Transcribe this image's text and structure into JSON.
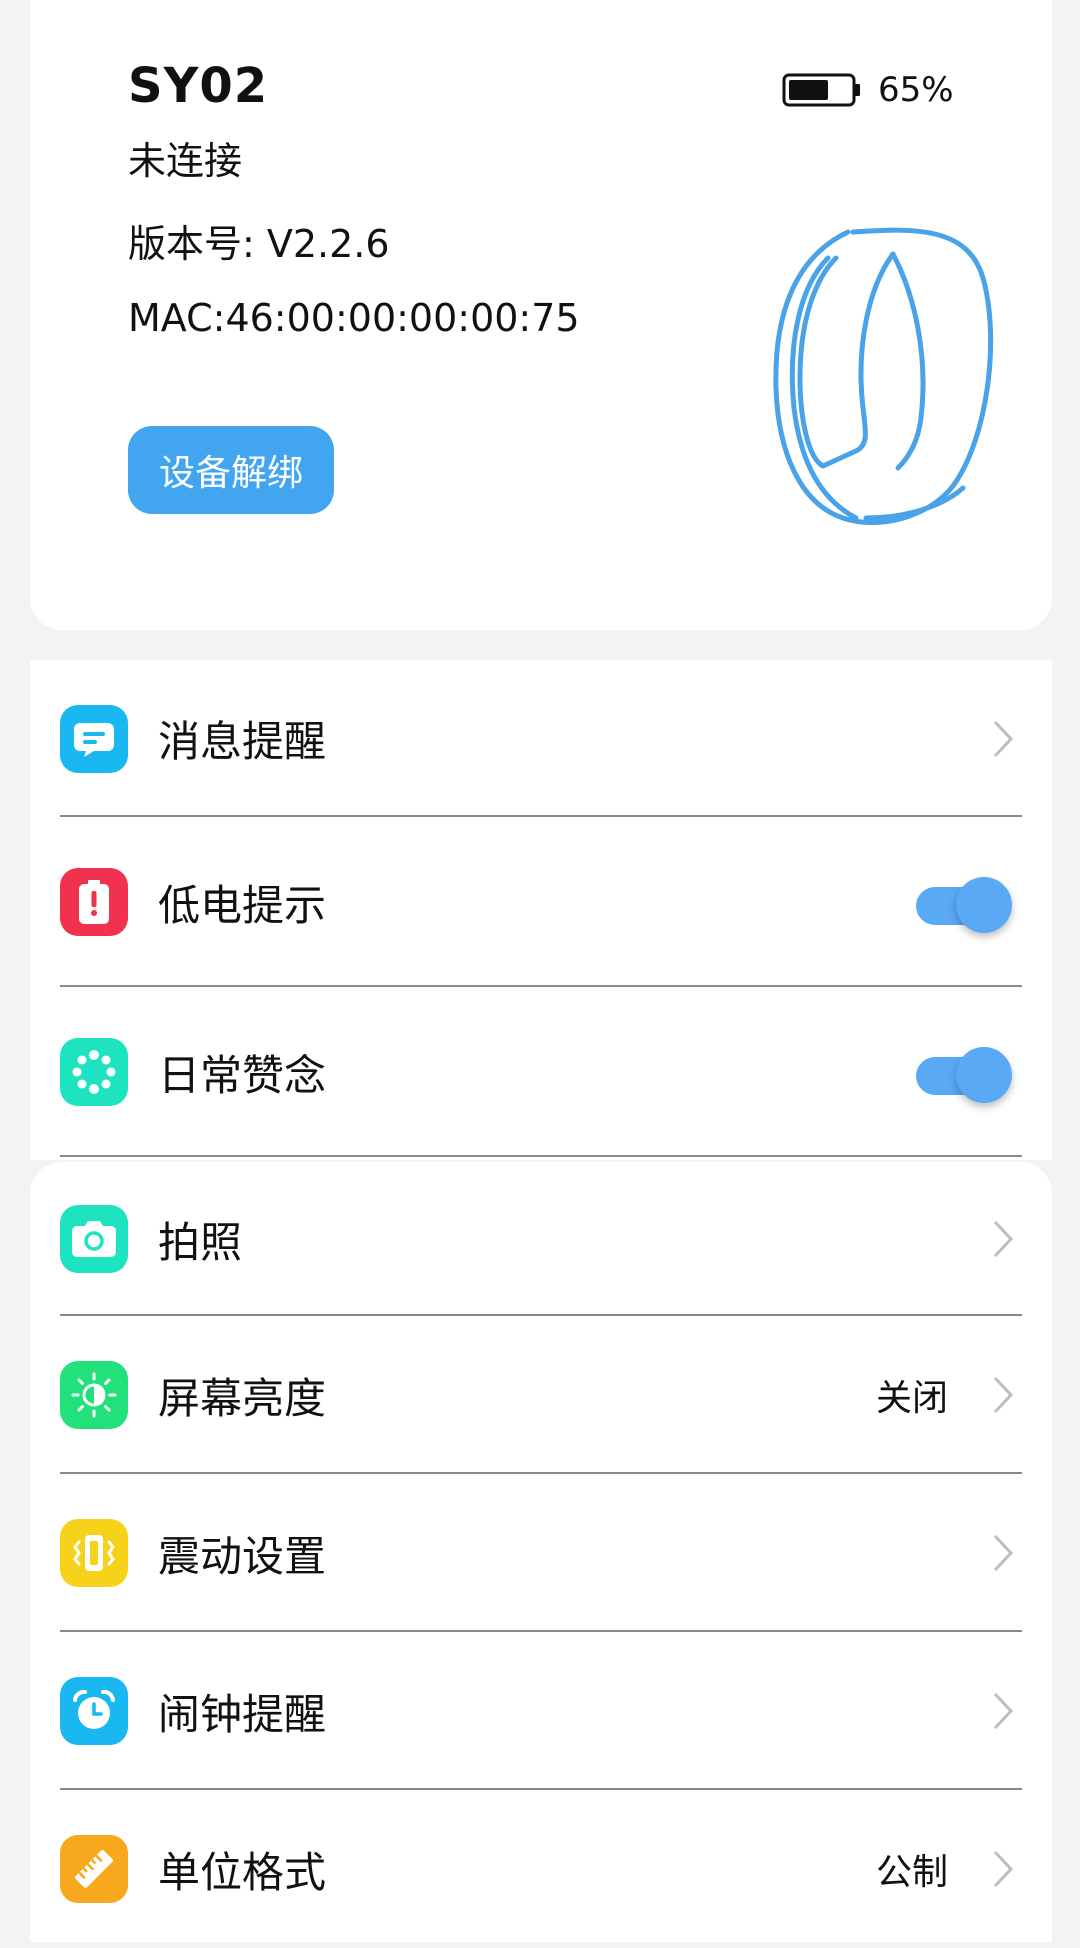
{
  "device": {
    "name": "SY02",
    "status": "未连接",
    "version": "版本号: V2.2.6",
    "mac": "MAC:46:00:00:00:00:75",
    "unbind_label": "设备解绑",
    "battery_percent": "65%",
    "battery_level": 0.65
  },
  "colors": {
    "accent": "#42a5f0",
    "toggle_on": "#5aa9f5",
    "ring_stroke": "#4aa3e8"
  },
  "menu_group_1": [
    {
      "label": "消息提醒",
      "icon": "message-icon",
      "icon_color": "#1ab8f0",
      "control": "chevron"
    },
    {
      "label": "低电提示",
      "icon": "low-battery-icon",
      "icon_color": "#f0324e",
      "control": "toggle",
      "on": true
    },
    {
      "label": "日常赞念",
      "icon": "beads-icon",
      "icon_color": "#1de3c0",
      "control": "toggle",
      "on": true
    }
  ],
  "menu_group_2": [
    {
      "label": "拍照",
      "icon": "camera-icon",
      "icon_color": "#1de3c0",
      "control": "chevron"
    },
    {
      "label": "屏幕亮度",
      "icon": "brightness-icon",
      "icon_color": "#22e07a",
      "control": "chevron",
      "value": "关闭"
    },
    {
      "label": "震动设置",
      "icon": "vibration-icon",
      "icon_color": "#f6d21a",
      "control": "chevron"
    },
    {
      "label": "闹钟提醒",
      "icon": "alarm-icon",
      "icon_color": "#1ab8f0",
      "control": "chevron"
    },
    {
      "label": "单位格式",
      "icon": "ruler-icon",
      "icon_color": "#f8a81c",
      "control": "chevron",
      "value": "公制"
    }
  ]
}
